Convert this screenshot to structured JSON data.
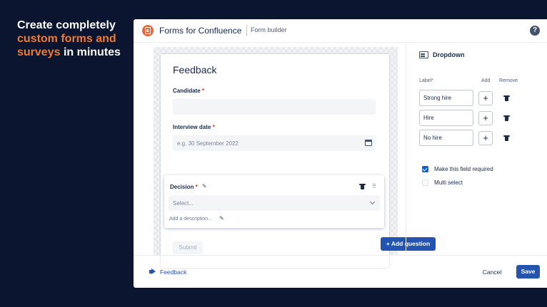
{
  "marketing": {
    "line1": "Create completely",
    "line2_accent": "custom forms and",
    "line3_accent": "surveys",
    "line3_rest": " in minutes"
  },
  "titlebar": {
    "app_icon": "forms-logo-icon",
    "app_title": "Forms for Confluence",
    "subtitle": "Form builder",
    "help_glyph": "?"
  },
  "form": {
    "title": "Feedback",
    "fields": [
      {
        "label": "Candidate",
        "required_mark": "*"
      },
      {
        "label": "Interview date",
        "required_mark": "*",
        "placeholder": "e.g. 30 September 2022",
        "icon": "calendar-icon"
      }
    ],
    "selected_question": {
      "label": "Decision",
      "required_mark": "*",
      "select_placeholder": "Select...",
      "description_link": "Add a description..."
    },
    "add_question_label": "Add question",
    "add_question_glyph": "+",
    "submit_label": "Submit"
  },
  "panel": {
    "title": "Dropdown",
    "icon": "dropdown-field-icon",
    "col_label": "Label",
    "col_label_required": "*",
    "col_add": "Add",
    "col_remove": "Remove",
    "options": [
      {
        "value": "Strong hire",
        "add_glyph": "+"
      },
      {
        "value": "Hire",
        "add_glyph": "+"
      },
      {
        "value": "No hire",
        "add_glyph": "+"
      }
    ],
    "required_checkbox": {
      "label": "Make this field required",
      "checked": true
    },
    "multi_checkbox": {
      "label": "Multi select",
      "checked": false
    }
  },
  "footer": {
    "feedback_label": "Feedback",
    "feedback_icon": "megaphone-icon",
    "cancel_label": "Cancel",
    "save_label": "Save"
  },
  "colors": {
    "background": "#0b1530",
    "accent_orange": "#f07b2c",
    "primary_blue": "#2354b0",
    "checkbox_blue": "#0b62d6",
    "required_red": "#de350b"
  }
}
